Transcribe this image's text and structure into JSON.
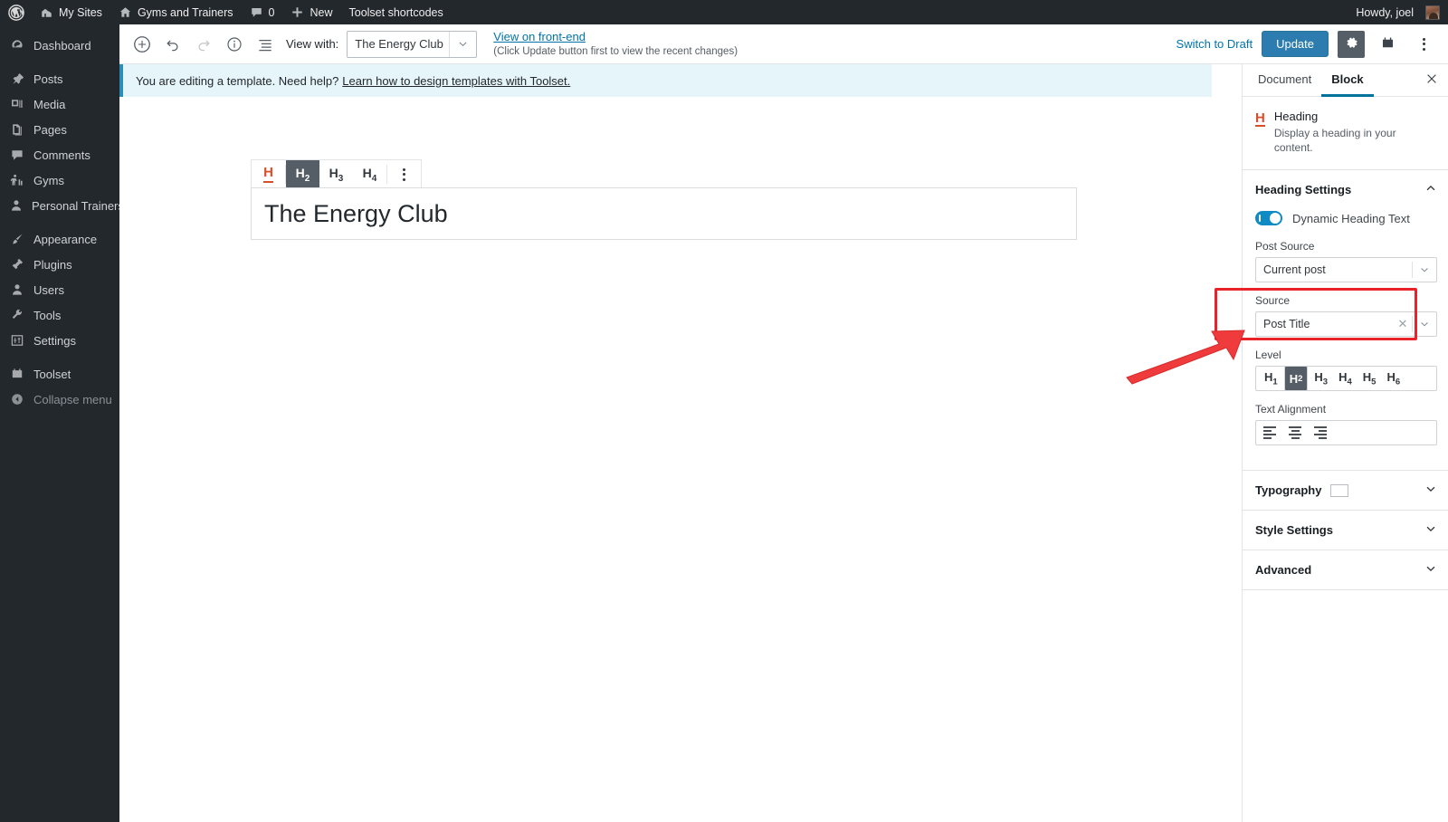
{
  "adminbar": {
    "logo_icon": "wordpress-logo-icon",
    "items": [
      {
        "label": "My Sites",
        "icon": "sites-icon"
      },
      {
        "label": "Gyms and Trainers",
        "icon": "home-icon"
      },
      {
        "label": "0",
        "icon": "comment-bubble-icon"
      },
      {
        "label": "New",
        "icon": "plus-icon"
      },
      {
        "label": "Toolset shortcodes",
        "icon": null
      }
    ],
    "howdy": "Howdy, joel",
    "avatar_icon": "user-avatar"
  },
  "adminmenu": {
    "items": [
      {
        "label": "Dashboard",
        "icon": "dashboard-icon"
      },
      {
        "label": "Posts",
        "icon": "pin-icon"
      },
      {
        "label": "Media",
        "icon": "media-icon"
      },
      {
        "label": "Pages",
        "icon": "pages-icon"
      },
      {
        "label": "Comments",
        "icon": "comments-icon"
      },
      {
        "label": "Gyms",
        "icon": "gyms-icon"
      },
      {
        "label": "Personal Trainers",
        "icon": "person-icon"
      },
      {
        "label": "Appearance",
        "icon": "appearance-brush-icon"
      },
      {
        "label": "Plugins",
        "icon": "plugins-plug-icon"
      },
      {
        "label": "Users",
        "icon": "users-icon"
      },
      {
        "label": "Tools",
        "icon": "tools-wrench-icon"
      },
      {
        "label": "Settings",
        "icon": "settings-sliders-icon"
      },
      {
        "label": "Toolset",
        "icon": "toolset-icon"
      },
      {
        "label": "Collapse menu",
        "icon": "collapse-arrow-icon"
      }
    ]
  },
  "editor_header": {
    "add_block_icon": "plus-circle-icon",
    "undo_icon": "undo-icon",
    "redo_icon": "redo-icon",
    "info_icon": "info-circle-icon",
    "outline_icon": "list-view-icon",
    "view_with_label": "View with:",
    "view_with_value": "The Energy Club",
    "front_end_link": "View on front-end",
    "front_end_hint": "(Click Update button first to view the recent changes)",
    "switch_to_draft": "Switch to Draft",
    "update_label": "Update",
    "settings_icon": "gear-icon",
    "toolset_icon": "toolset-icon",
    "more_icon": "ellipsis-vertical-icon"
  },
  "notice": {
    "text": "You are editing a template. Need help?",
    "link": "Learn how to design templates with Toolset.",
    "accent_color": "#2a8fb8"
  },
  "block_toolbar": {
    "block_type_icon": "heading-h-icon",
    "levels": [
      {
        "label": "H",
        "sub": "2",
        "selected": true
      },
      {
        "label": "H",
        "sub": "3",
        "selected": false
      },
      {
        "label": "H",
        "sub": "4",
        "selected": false
      }
    ],
    "more_icon": "ellipsis-vertical-icon"
  },
  "canvas": {
    "heading_text": "The Energy Club"
  },
  "sidebar": {
    "tabs": [
      {
        "label": "Document",
        "active": false
      },
      {
        "label": "Block",
        "active": true
      }
    ],
    "close_icon": "close-icon",
    "block_card": {
      "icon": "heading-h-icon",
      "title": "Heading",
      "description": "Display a heading in your content."
    },
    "heading_settings": {
      "title": "Heading Settings",
      "chevron_icon": "chevron-up-icon",
      "toggle_label": "Dynamic Heading Text",
      "toggle_on": true,
      "toggle_color": "#0e8bc4",
      "post_source_label": "Post Source",
      "post_source_value": "Current post",
      "source_label": "Source",
      "source_value": "Post Title",
      "source_clear_icon": "clear-x-icon",
      "source_dropdown_icon": "chevron-down-icon",
      "level_label": "Level",
      "levels": [
        {
          "label": "H",
          "sub": "1",
          "selected": false
        },
        {
          "label": "H",
          "sub": "2",
          "selected": true
        },
        {
          "label": "H",
          "sub": "3",
          "selected": false
        },
        {
          "label": "H",
          "sub": "4",
          "selected": false
        },
        {
          "label": "H",
          "sub": "5",
          "selected": false
        },
        {
          "label": "H",
          "sub": "6",
          "selected": false
        }
      ],
      "text_alignment_label": "Text Alignment",
      "alignments": [
        "align-left-icon",
        "align-center-icon",
        "align-right-icon"
      ]
    },
    "panels": [
      {
        "title": "Typography",
        "has_swatch": true,
        "chevron_icon": "chevron-down-icon"
      },
      {
        "title": "Style Settings",
        "has_swatch": false,
        "chevron_icon": "chevron-down-icon"
      },
      {
        "title": "Advanced",
        "has_swatch": false,
        "chevron_icon": "chevron-down-icon"
      }
    ]
  },
  "annotation": {
    "highlight_color": "#e8242a",
    "target": "source-field",
    "arrow": "red-pointer-arrow"
  }
}
